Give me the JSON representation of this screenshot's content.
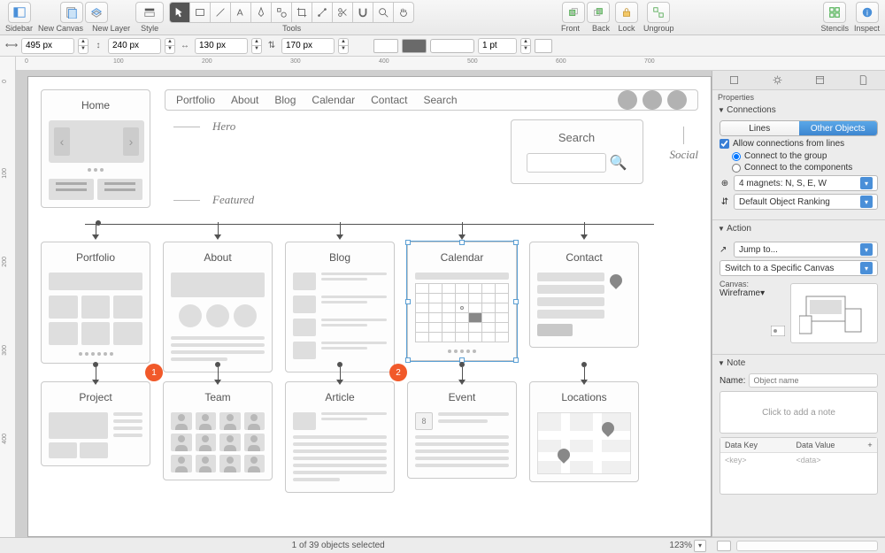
{
  "toolbar": {
    "sidebar": "Sidebar",
    "new_canvas": "New Canvas",
    "new_layer": "New Layer",
    "style": "Style",
    "tools": "Tools",
    "front": "Front",
    "back": "Back",
    "lock": "Lock",
    "ungroup": "Ungroup",
    "stencils": "Stencils",
    "inspect": "Inspect"
  },
  "dimensions": {
    "x": "495 px",
    "y": "240 px",
    "w": "130 px",
    "h": "170 px",
    "stroke": "1 pt"
  },
  "nav": {
    "items": [
      "Portfolio",
      "About",
      "Blog",
      "Calendar",
      "Contact",
      "Search"
    ]
  },
  "labels": {
    "home": "Home",
    "hero": "Hero",
    "featured": "Featured",
    "search": "Search",
    "social": "Social"
  },
  "cards_row2": [
    "Portfolio",
    "About",
    "Blog",
    "Calendar",
    "Contact"
  ],
  "cards_row3": [
    "Project",
    "Team",
    "Article",
    "Event",
    "Locations"
  ],
  "badges": {
    "b1": "1",
    "b2": "2"
  },
  "event_day": "8",
  "inspector": {
    "panel_title": "Properties",
    "connections": "Connections",
    "seg_lines": "Lines",
    "seg_other": "Other Objects",
    "allow": "Allow connections from lines",
    "to_group": "Connect to the group",
    "to_components": "Connect to the components",
    "magnets": "4 magnets: N, S, E, W",
    "ranking": "Default Object Ranking",
    "action": "Action",
    "jump": "Jump to...",
    "switch": "Switch to a Specific Canvas",
    "canvas_label": "Canvas:",
    "canvas_value": "Wireframe",
    "note": "Note",
    "name_label": "Name:",
    "name_placeholder": "Object name",
    "note_placeholder": "Click to add a note",
    "data_key": "Data Key",
    "data_value": "Data Value",
    "key_ph": "<key>",
    "val_ph": "<data>"
  },
  "status": {
    "selection": "1 of 39 objects selected",
    "zoom": "123%"
  },
  "ruler_h": [
    "0",
    "100",
    "200",
    "300",
    "400",
    "500",
    "600",
    "700"
  ],
  "ruler_v": [
    "0",
    "100",
    "200",
    "300",
    "400"
  ]
}
